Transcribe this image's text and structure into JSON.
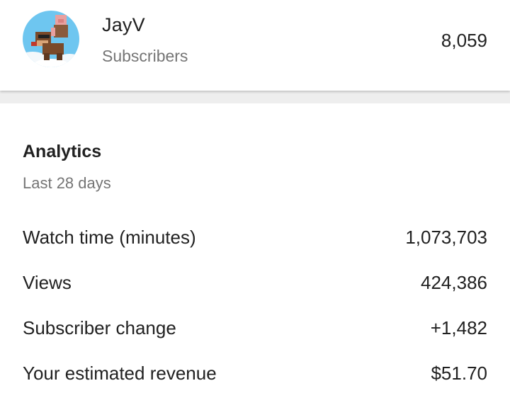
{
  "channel": {
    "name": "JayV",
    "subscribers_label": "Subscribers",
    "subscribers_count": "8,059"
  },
  "analytics": {
    "title": "Analytics",
    "period": "Last 28 days",
    "metrics": [
      {
        "label": "Watch time (minutes)",
        "value": "1,073,703"
      },
      {
        "label": "Views",
        "value": "424,386"
      },
      {
        "label": "Subscriber change",
        "value": "+1,482"
      },
      {
        "label": "Your estimated revenue",
        "value": "$51.70"
      }
    ]
  },
  "colors": {
    "primary_text": "#212121",
    "secondary_text": "#757575",
    "divider_band": "#eeeeee",
    "avatar_sky": "#6ec6f0"
  }
}
